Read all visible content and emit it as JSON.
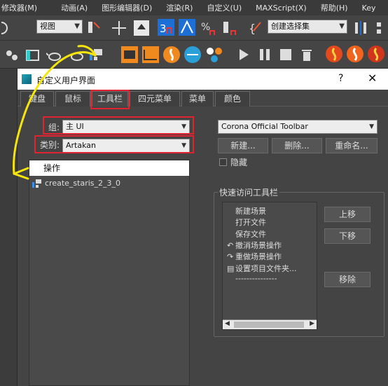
{
  "menu": [
    "修改器(M)",
    "动画(A)",
    "图形编辑器(D)",
    "渲染(R)",
    "自定义(U)",
    "MAXScript(X)",
    "帮助(H)",
    "Key"
  ],
  "toolbar": {
    "view_select": "视图",
    "selection_set": "创建选择集"
  },
  "dialog": {
    "title": "自定义用户界面",
    "help": "?",
    "close": "✕",
    "tabs": [
      "键盘",
      "鼠标",
      "工具栏",
      "四元菜单",
      "菜单",
      "颜色"
    ],
    "active_tab": "工具栏",
    "group_label": "组:",
    "group_value": "主 UI",
    "category_label": "类别:",
    "category_value": "Artakan",
    "actions_header": "操作",
    "actions": [
      "create_staris_2_3_0"
    ],
    "toolbar_select": "Corona Official Toolbar",
    "buttons": {
      "new": "新建...",
      "delete": "删除...",
      "rename": "重命名..."
    },
    "hide_label": "隐藏",
    "quick_access_label": "快速访问工具栏",
    "quick_items": [
      {
        "icon": "",
        "label": "新建场景"
      },
      {
        "icon": "",
        "label": "打开文件"
      },
      {
        "icon": "",
        "label": "保存文件"
      },
      {
        "icon": "undo-arrow-icon",
        "label": "撤消场景操作"
      },
      {
        "icon": "redo-arrow-icon",
        "label": "重做场景操作"
      },
      {
        "icon": "project-folder-icon",
        "label": "设置项目文件夹..."
      },
      {
        "icon": "",
        "label": "---------------"
      }
    ],
    "side_buttons": {
      "up": "上移",
      "down": "下移",
      "remove": "移除"
    }
  },
  "colors": {
    "annotation_red": "#e0242f",
    "annotation_yellow": "#f5e50a"
  }
}
